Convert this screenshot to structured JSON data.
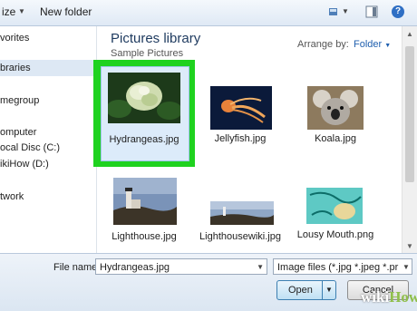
{
  "toolbar": {
    "organize_label": "ize",
    "new_folder_label": "New folder"
  },
  "sidebar": {
    "items": [
      {
        "label": "vorites",
        "selected": false
      },
      {
        "label": "braries",
        "selected": true
      },
      {
        "label": "megroup",
        "selected": false
      },
      {
        "label": "omputer",
        "selected": false
      },
      {
        "label": "ocal Disc (C:)",
        "selected": false
      },
      {
        "label": "ikiHow (D:)",
        "selected": false
      },
      {
        "label": "twork",
        "selected": false
      }
    ]
  },
  "main": {
    "library_title": "Pictures library",
    "library_subtitle": "Sample Pictures",
    "arrange_by_label": "Arrange by:",
    "arrange_by_value": "Folder",
    "files": [
      {
        "name": "Hydrangeas.jpg",
        "selected": true
      },
      {
        "name": "Jellyfish.jpg",
        "selected": false
      },
      {
        "name": "Koala.jpg",
        "selected": false
      },
      {
        "name": "Lighthouse.jpg",
        "selected": false
      },
      {
        "name": "Lighthousewiki.jpg",
        "selected": false
      },
      {
        "name": "Lousy Mouth.png",
        "selected": false
      }
    ]
  },
  "bottom": {
    "file_name_label": "File name:",
    "file_name_value": "Hydrangeas.jpg",
    "file_type_value": "Image files (*.jpg *.jpeg *.pr",
    "open_label": "Open",
    "cancel_label": "Cancel"
  },
  "highlight_color": "#1fd21f",
  "watermark": "wikiHow"
}
